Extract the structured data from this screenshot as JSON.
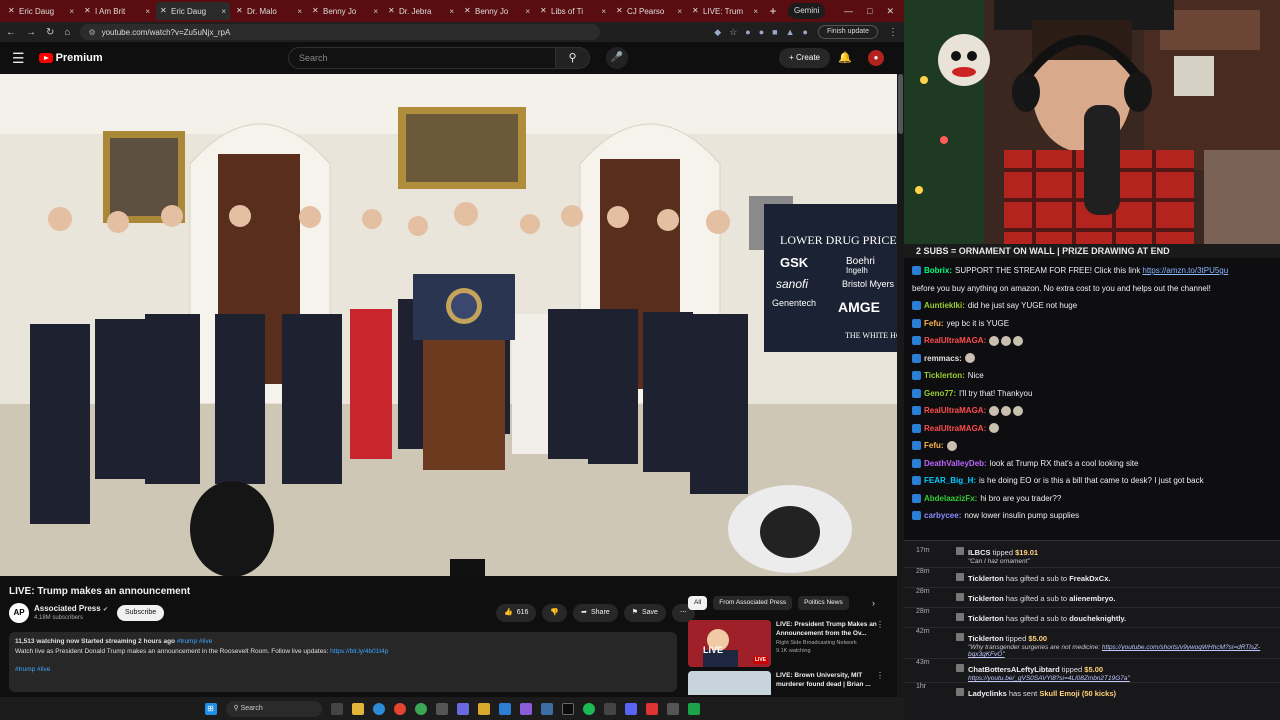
{
  "browser": {
    "tabs": [
      {
        "label": "Eric Daug",
        "active": false
      },
      {
        "label": "I Am Brit",
        "active": false
      },
      {
        "label": "Eric Daug",
        "active": true
      },
      {
        "label": "Dr. Malo",
        "active": false
      },
      {
        "label": "Benny Jo",
        "active": false
      },
      {
        "label": "Dr. Jebra",
        "active": false
      },
      {
        "label": "Benny Jo",
        "active": false
      },
      {
        "label": "Libs of Ti",
        "active": false
      },
      {
        "label": "CJ Pearso",
        "active": false
      },
      {
        "label": "LIVE: Trum",
        "active": false
      }
    ],
    "gemini_label": "Gemini",
    "url": "youtube.com/watch?v=Zu5uNjx_rpA",
    "finish_update": "Finish update"
  },
  "youtube": {
    "logo_text": "Premium",
    "search_placeholder": "Search",
    "create_label": "Create",
    "video": {
      "podium_sign_lines": [
        "LOWER DRUG PRICES",
        "GSK",
        "Boehri",
        "Ingelh",
        "sanofi",
        "Bristol Myers",
        "Genentech",
        "AMGE",
        "THE WHITE HOU"
      ]
    },
    "title": "LIVE: Trump makes an announcement",
    "channel": {
      "name": "Associated Press",
      "subs": "4.18M subscribers",
      "avatar_text": "AP"
    },
    "subscribe_label": "Subscribe",
    "actions": {
      "likes": "616",
      "share": "Share",
      "save": "Save"
    },
    "description": {
      "stats": "11,513 watching now  Started streaming 2 hours ago",
      "tags_inline": "#trump #live",
      "body": "Watch live as President Donald Trump makes an announcement in the Roosevelt Room. Follow live updates: ",
      "link": "https://bit.ly/4b01t4p",
      "tags": "#trump #live"
    },
    "chips": [
      "All",
      "From Associated Press",
      "Politics News"
    ],
    "recommendations": [
      {
        "title": "LIVE: President Trump Makes an Announcement from the Ov...",
        "channel": "Right Side Broadcasting Network",
        "meta": "9.1K watching",
        "badge": "LIVE"
      },
      {
        "title": "LIVE: Brown University, MIT murderer found dead | Brian ...",
        "channel": "",
        "meta": "",
        "badge": ""
      }
    ]
  },
  "taskbar": {
    "search_label": "Search"
  },
  "stream": {
    "banner": "2 SUBS = ORNAMENT ON WALL | PRIZE DRAWING AT END"
  },
  "chat": [
    {
      "user": "Bobrix:",
      "color": "#00ff7f",
      "text": "SUPPORT THE STREAM FOR FREE! Click this link",
      "link": "https://amzn.to/3tPU5gu"
    },
    {
      "user": "",
      "color": "#efeff1",
      "text": "before you buy anything on amazon. No extra cost to you and helps out the channel!",
      "link": ""
    },
    {
      "user": "Auntieklki:",
      "color": "#9acd32",
      "text": "did he just say YUGE not huge",
      "link": ""
    },
    {
      "user": "Fefu:",
      "color": "#ffb347",
      "text": "yep bc it is YUGE",
      "link": ""
    },
    {
      "user": "RealUltraMAGA:",
      "color": "#ff4d4d",
      "text": "",
      "link": "",
      "emotes": 3
    },
    {
      "user": "remmacs:",
      "color": "#e0e0e0",
      "text": "",
      "link": "",
      "emotes": 1
    },
    {
      "user": "Ticklerton:",
      "color": "#9acd32",
      "text": "Nice",
      "link": ""
    },
    {
      "user": "Geno77:",
      "color": "#9acd32",
      "text": "I'll try that! Thankyou",
      "link": ""
    },
    {
      "user": "RealUltraMAGA:",
      "color": "#ff4d4d",
      "text": "",
      "link": "",
      "emotes": 3
    },
    {
      "user": "RealUltraMAGA:",
      "color": "#ff4d4d",
      "text": "",
      "link": "",
      "emotes": 1
    },
    {
      "user": "Fefu:",
      "color": "#ffb347",
      "text": "",
      "link": "",
      "emotes": 1
    },
    {
      "user": "DeathValleyDeb:",
      "color": "#bb66ff",
      "text": "look at Trump RX that's a cool looking site",
      "link": ""
    },
    {
      "user": "FEAR_Big_H:",
      "color": "#00ccff",
      "text": "is he doing EO or is this a bill that came to desk? I just got back",
      "link": ""
    },
    {
      "user": "AbdelaazizFx:",
      "color": "#33cc33",
      "text": "hi bro are you trader??",
      "link": ""
    },
    {
      "user": "carbycee:",
      "color": "#8a8aff",
      "text": "now lower insulin pump supplies",
      "link": ""
    }
  ],
  "events": [
    {
      "time": "17m",
      "name": "ILBCS",
      "text": " tipped ",
      "amount": "$19.01",
      "quote": "\"Can I haz ornament\"",
      "quote_link": ""
    },
    {
      "time": "28m",
      "name": "Ticklerton",
      "text": " has gifted a sub to ",
      "target": "FreakDxCx.",
      "amount": ""
    },
    {
      "time": "28m",
      "name": "Ticklerton",
      "text": " has gifted a sub to ",
      "target": "alienembryo.",
      "amount": ""
    },
    {
      "time": "28m",
      "name": "Ticklerton",
      "text": " has gifted a sub to ",
      "target": "doucheknightly.",
      "amount": ""
    },
    {
      "time": "42m",
      "name": "Ticklerton",
      "text": " tipped ",
      "amount": "$5.00",
      "quote": "\"Why transgender surgeries are not medicine: ",
      "quote_link": "https://youtube.com/shorts/v9ywoqWHhcM?si=dRTlsZ-bqx3gKFvO\""
    },
    {
      "time": "43m",
      "name": "ChatBottersALeftyLibtard",
      "text": " tipped ",
      "amount": "$5.00",
      "quote": "",
      "quote_link": "https://youtu.be/_gVS0SAVYl8?si=4Ll08Zmbn2T19G7a\""
    },
    {
      "time": "1hr",
      "name": "Ladyclinks",
      "text": " has sent ",
      "amount": "Skull Emoji (50 kicks)",
      "quote": "",
      "quote_link": ""
    }
  ]
}
